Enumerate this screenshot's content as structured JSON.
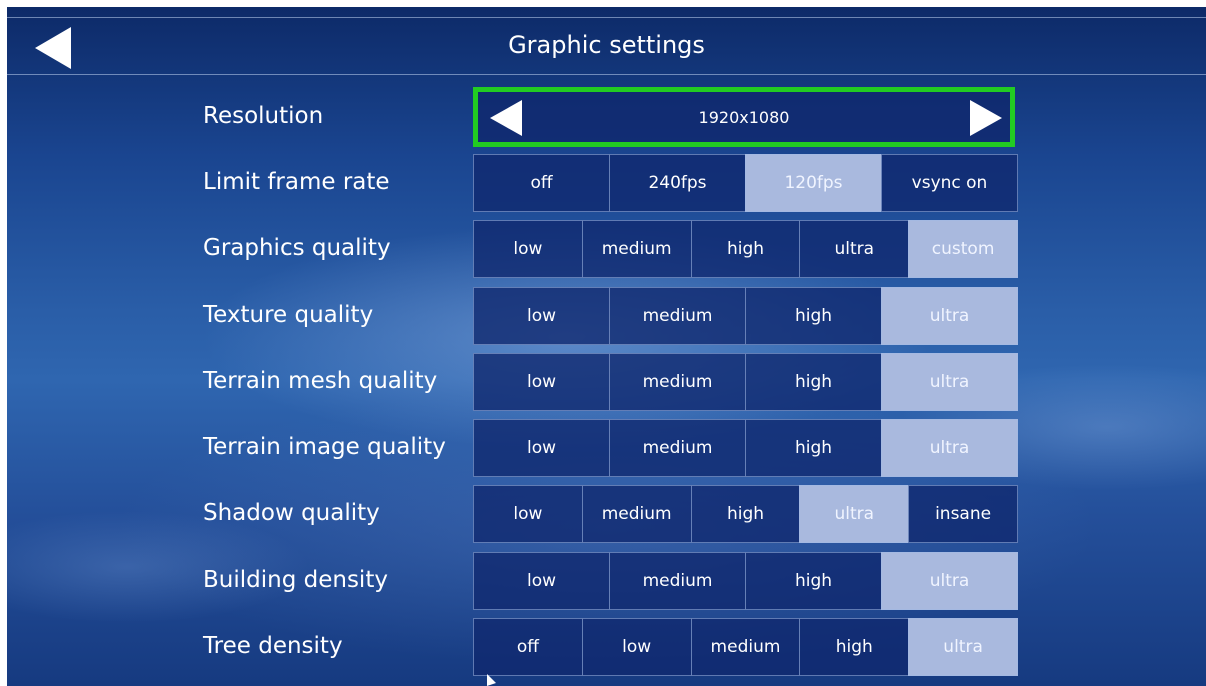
{
  "header": {
    "title": "Graphic settings",
    "back_icon": "back-arrow-icon"
  },
  "resolution": {
    "label": "Resolution",
    "value": "1920x1080",
    "highlight_color": "#22cc22"
  },
  "colors": {
    "selected": "#a9b9de",
    "option_bg": "#10286e"
  },
  "settings": [
    {
      "label": "Limit frame rate",
      "options": [
        "off",
        "240fps",
        "120fps",
        "vsync on"
      ],
      "selected": 2
    },
    {
      "label": "Graphics quality",
      "options": [
        "low",
        "medium",
        "high",
        "ultra",
        "custom"
      ],
      "selected": 4
    },
    {
      "label": "Texture quality",
      "options": [
        "low",
        "medium",
        "high",
        "ultra"
      ],
      "selected": 3
    },
    {
      "label": "Terrain mesh quality",
      "options": [
        "low",
        "medium",
        "high",
        "ultra"
      ],
      "selected": 3
    },
    {
      "label": "Terrain image quality",
      "options": [
        "low",
        "medium",
        "high",
        "ultra"
      ],
      "selected": 3
    },
    {
      "label": "Shadow quality",
      "options": [
        "low",
        "medium",
        "high",
        "ultra",
        "insane"
      ],
      "selected": 3
    },
    {
      "label": "Building density",
      "options": [
        "low",
        "medium",
        "high",
        "ultra"
      ],
      "selected": 3
    },
    {
      "label": "Tree density",
      "options": [
        "off",
        "low",
        "medium",
        "high",
        "ultra"
      ],
      "selected": 4
    }
  ]
}
